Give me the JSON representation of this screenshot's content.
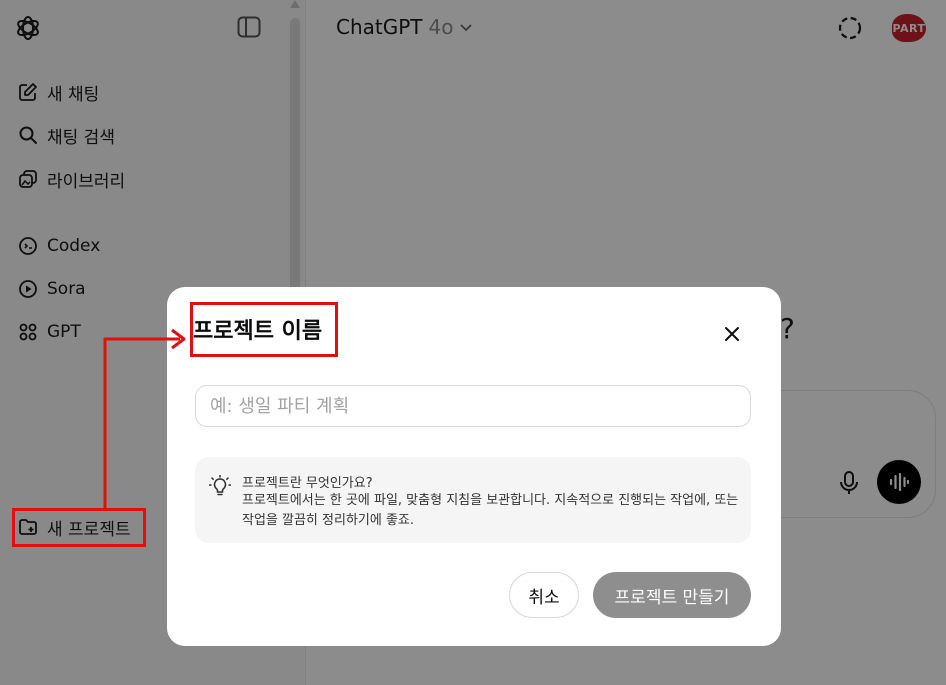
{
  "app": {
    "model_name": "ChatGPT",
    "model_version": "4o",
    "avatar_text": "PART"
  },
  "sidebar": {
    "items": [
      {
        "label": "새 채팅",
        "icon": "edit-icon"
      },
      {
        "label": "채팅 검색",
        "icon": "search-icon"
      },
      {
        "label": "라이브러리",
        "icon": "library-icon"
      },
      {
        "label": "Codex",
        "icon": "codex-icon"
      },
      {
        "label": "Sora",
        "icon": "play-circle-icon"
      },
      {
        "label": "GPT",
        "icon": "grid-icon"
      }
    ],
    "new_project_label": "새 프로젝트"
  },
  "main": {
    "partial_heading": "?"
  },
  "modal": {
    "title": "프로젝트 이름",
    "input_placeholder": "예: 생일 파티 계획",
    "input_value": "",
    "info_title": "프로젝트란 무엇인가요?",
    "info_body": "프로젝트에서는 한 곳에 파일, 맞춤형 지침을 보관합니다. 지속적으로 진행되는 작업에, 또는 작업을 깔끔히 정리하기에 좋죠.",
    "cancel_label": "취소",
    "create_label": "프로젝트 만들기"
  },
  "colors": {
    "highlight": "#e01010",
    "create_button_disabled": "#8e8e8e",
    "avatar": "#c8202c"
  }
}
